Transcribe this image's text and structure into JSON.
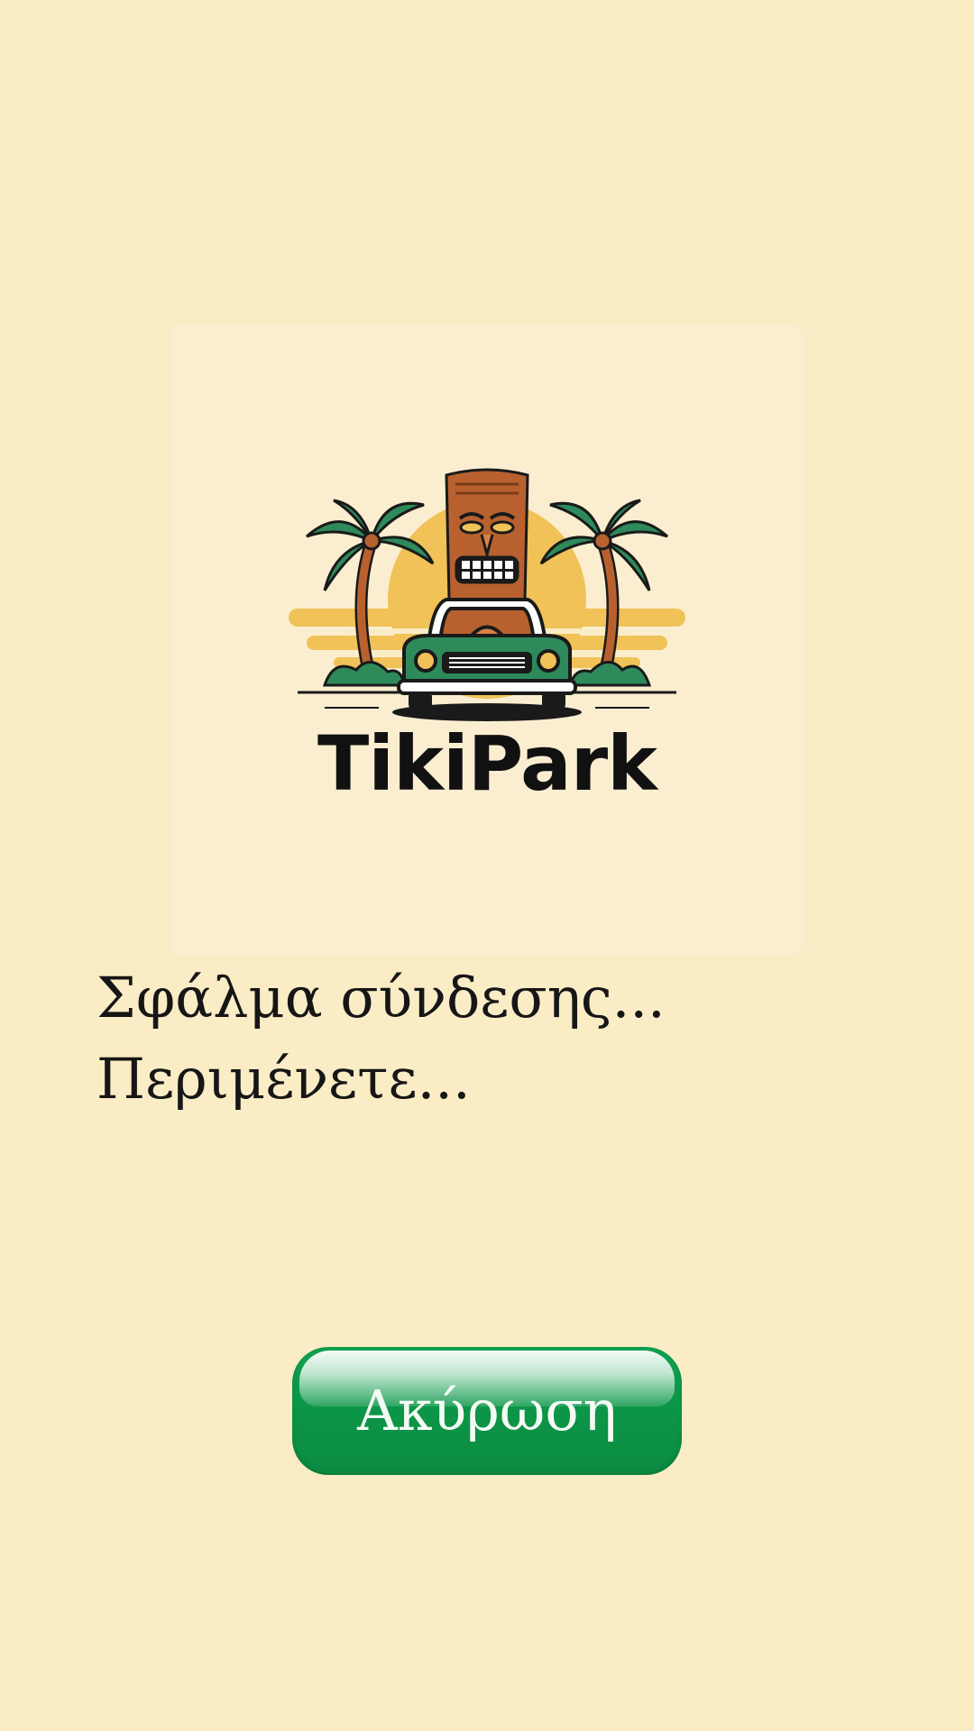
{
  "app": {
    "logo_text": "TikiPark"
  },
  "status": {
    "line1": "Σφάλμα σύνδεσης...",
    "line2": "Περιμένετε..."
  },
  "actions": {
    "cancel_label": "Ακύρωση"
  },
  "colors": {
    "background": "#faecc5",
    "button": "#0c9447",
    "text": "#161616"
  },
  "icons": {
    "logo": "tiki-palm-car-logo"
  }
}
